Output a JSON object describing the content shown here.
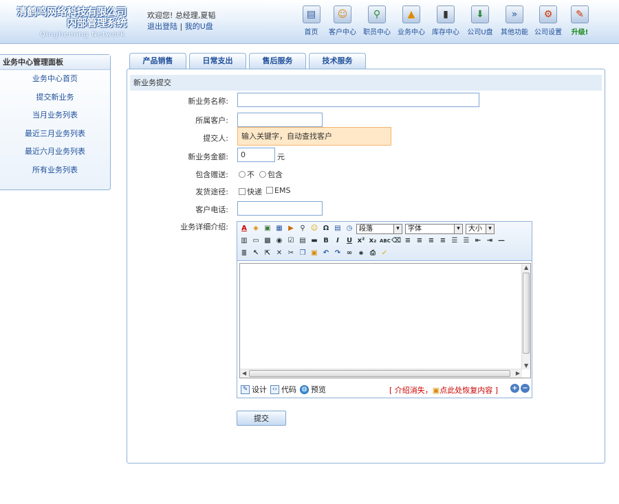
{
  "header": {
    "logo_title_line1": "清鹤鸣网络科技有限公司",
    "logo_title_line2": "内部管理系统",
    "logo_subtitle": "Qingheming Network",
    "welcome_text": "欢迎您! 总经理,夏韬",
    "logout_link": "退出登陆",
    "separator": "|",
    "my_disk_link": "我的U盘",
    "nav": [
      {
        "label": "首页",
        "icon": "home-icon",
        "glyph": "▤"
      },
      {
        "label": "客户中心",
        "icon": "customer-icon",
        "glyph": "☺"
      },
      {
        "label": "职员中心",
        "icon": "staff-icon",
        "glyph": "⚲"
      },
      {
        "label": "业务中心",
        "icon": "business-icon",
        "glyph": "▲"
      },
      {
        "label": "库存中心",
        "icon": "inventory-icon",
        "glyph": "▮"
      },
      {
        "label": "公司U盘",
        "icon": "udisk-icon",
        "glyph": "⬇"
      },
      {
        "label": "其他功能",
        "icon": "other-icon",
        "glyph": "»"
      },
      {
        "label": "公司设置",
        "icon": "settings-icon",
        "glyph": "⚙"
      },
      {
        "label": "升级!",
        "icon": "upgrade-icon",
        "glyph": "✎"
      }
    ]
  },
  "sidebar": {
    "title": "业务中心管理面板",
    "items": [
      {
        "label": "业务中心首页"
      },
      {
        "label": "提交新业务"
      },
      {
        "label": "当月业务列表"
      },
      {
        "label": "最近三月业务列表"
      },
      {
        "label": "最近六月业务列表"
      },
      {
        "label": "所有业务列表"
      }
    ]
  },
  "tabs": [
    {
      "label": "产品销售"
    },
    {
      "label": "日常支出"
    },
    {
      "label": "售后服务"
    },
    {
      "label": "技术服务"
    }
  ],
  "section_title": "新业务提交",
  "form": {
    "name_label": "新业务名称:",
    "name_value": "",
    "customer_label": "所属客户:",
    "customer_value": "",
    "submitter_label": "提交人:",
    "submitter_hint": "输入关键字，自动查找客户",
    "amount_label": "新业务金额:",
    "amount_value": "0",
    "amount_unit": "元",
    "gift_label": "包含赠送:",
    "gift_options": [
      "不",
      "包含"
    ],
    "shipping_label": "发货途径:",
    "shipping_options": [
      "快递",
      "EMS"
    ],
    "phone_label": "客户电话:",
    "phone_value": "",
    "detail_label": "业务详细介绍:",
    "submit_label": "提交"
  },
  "editor": {
    "paragraph_select": "段落",
    "font_select": "字体",
    "size_select": "大小",
    "mode_design": "设计",
    "mode_code": "代码",
    "mode_preview": "预览",
    "restore_prefix": "[ 介绍消失，",
    "restore_link": "点此处恢复内容",
    "restore_suffix": " ]"
  }
}
